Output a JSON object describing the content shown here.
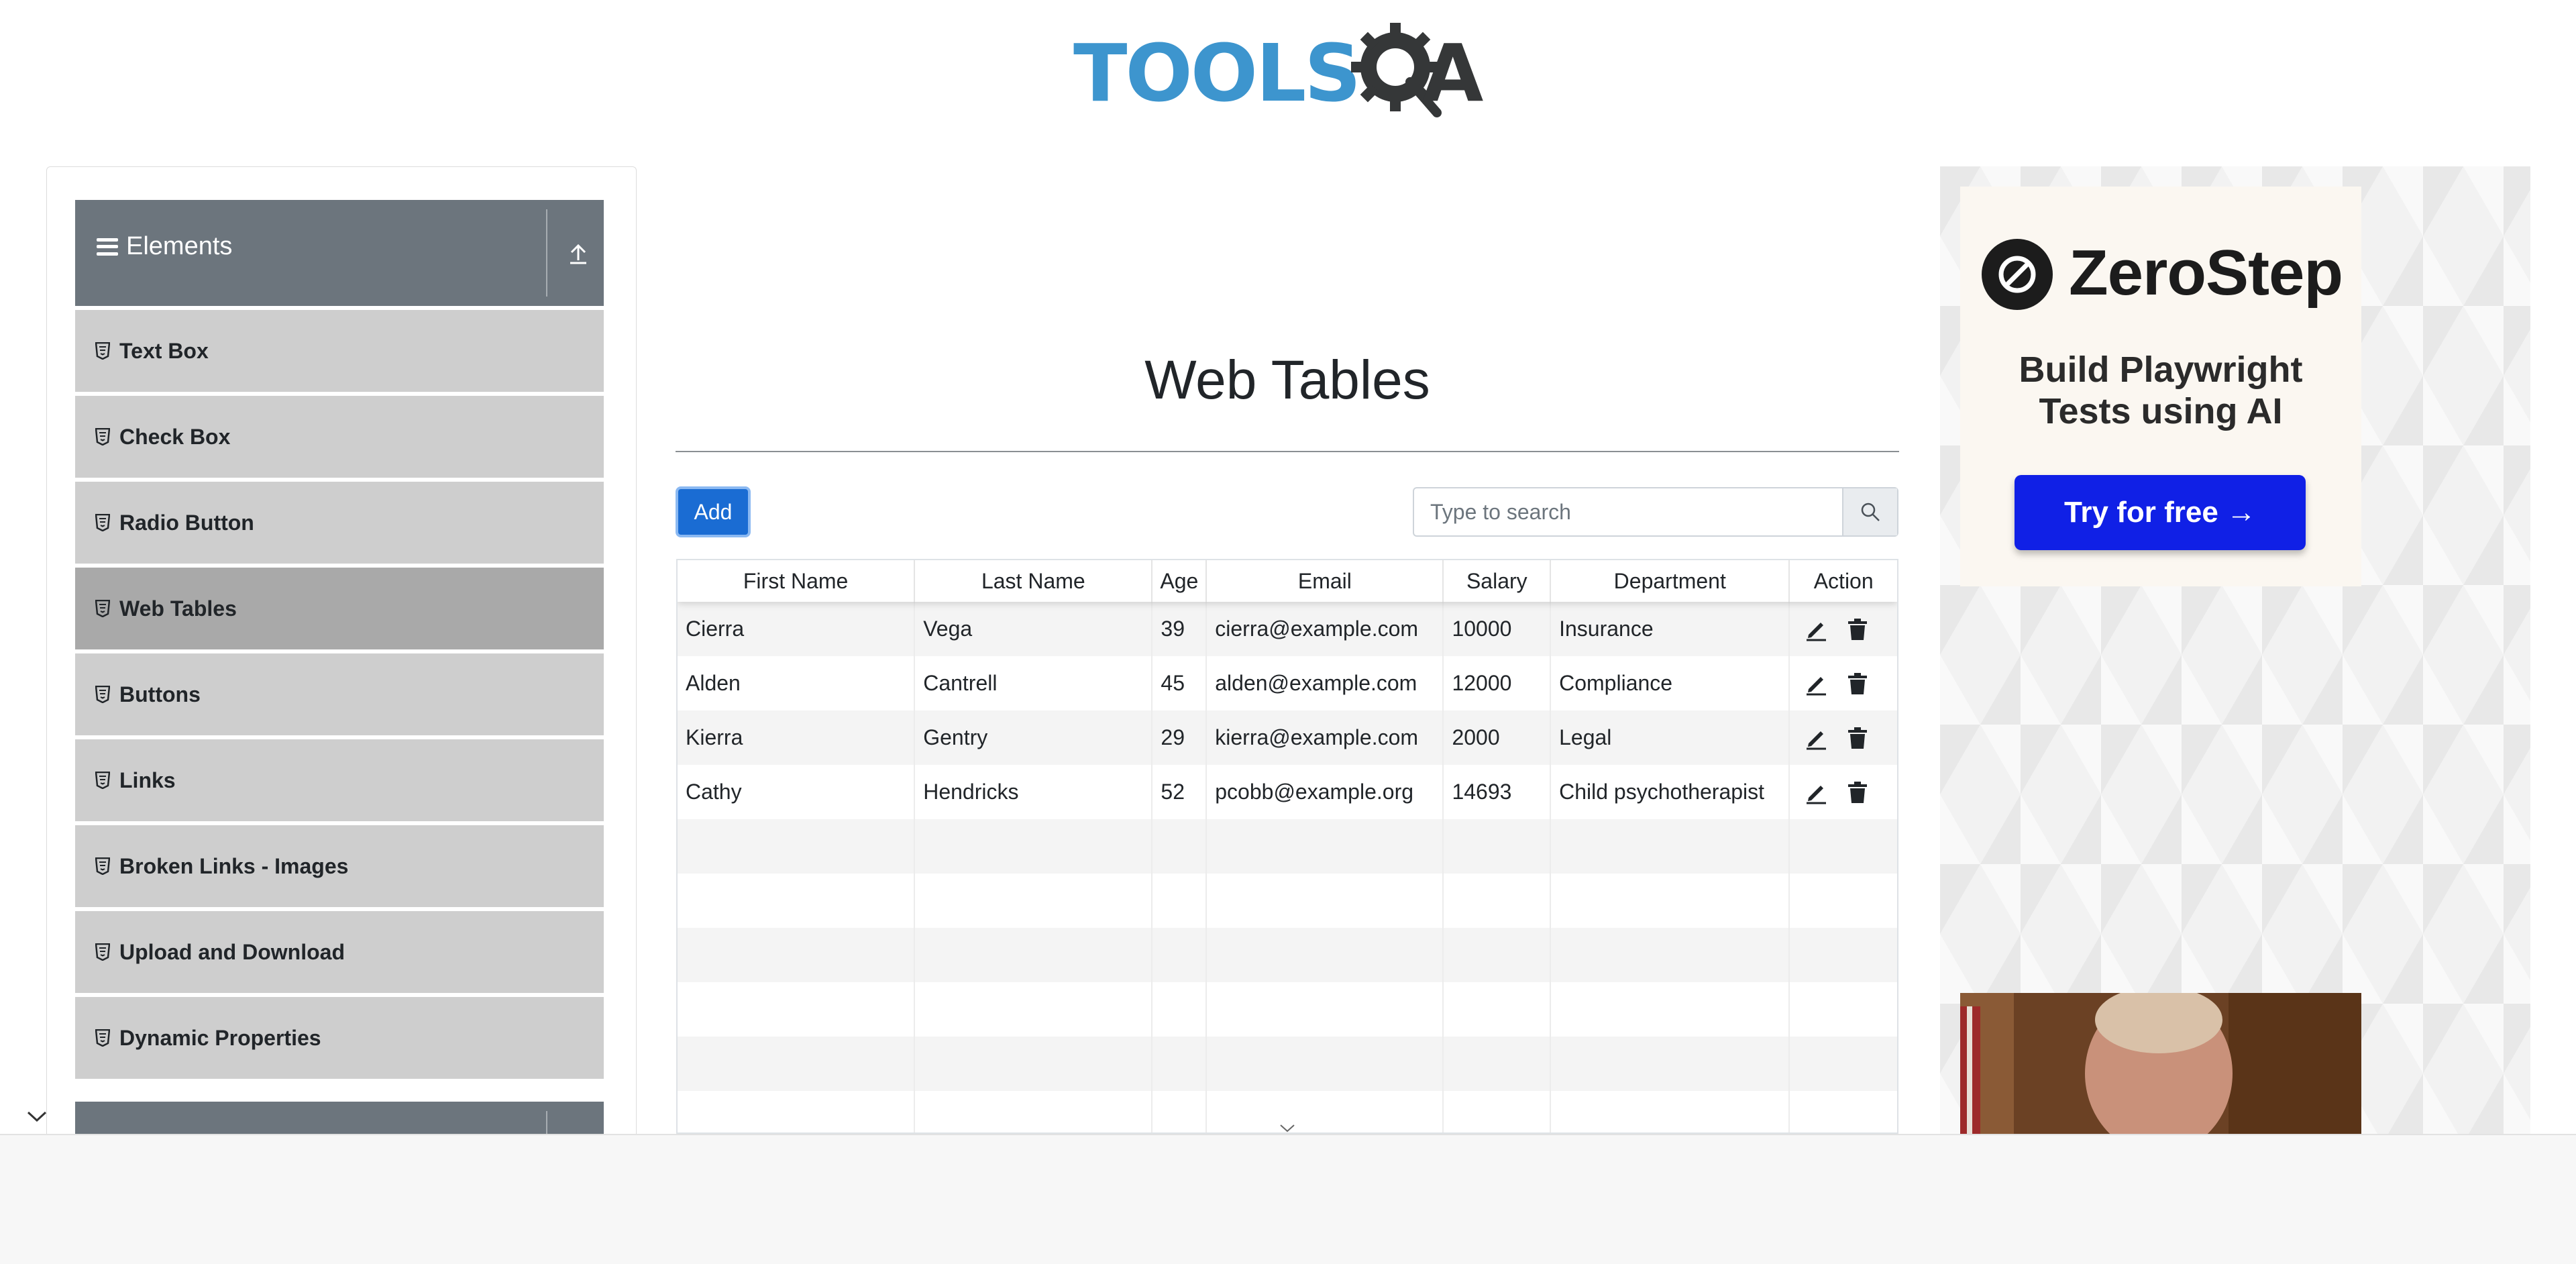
{
  "header": {
    "logo_text_left": "TOOLS",
    "logo_text_right": "A"
  },
  "sidebar": {
    "group_title": "Elements",
    "items": [
      {
        "label": "Text Box",
        "active": false
      },
      {
        "label": "Check Box",
        "active": false
      },
      {
        "label": "Radio Button",
        "active": false
      },
      {
        "label": "Web Tables",
        "active": true
      },
      {
        "label": "Buttons",
        "active": false
      },
      {
        "label": "Links",
        "active": false
      },
      {
        "label": "Broken Links - Images",
        "active": false
      },
      {
        "label": "Upload and Download",
        "active": false
      },
      {
        "label": "Dynamic Properties",
        "active": false
      }
    ]
  },
  "main": {
    "title": "Web Tables",
    "add_label": "Add",
    "search_placeholder": "Type to search",
    "columns": [
      "First Name",
      "Last Name",
      "Age",
      "Email",
      "Salary",
      "Department",
      "Action"
    ],
    "rows": [
      [
        "Cierra",
        "Vega",
        "39",
        "cierra@example.com",
        "10000",
        "Insurance"
      ],
      [
        "Alden",
        "Cantrell",
        "45",
        "alden@example.com",
        "12000",
        "Compliance"
      ],
      [
        "Kierra",
        "Gentry",
        "29",
        "kierra@example.com",
        "2000",
        "Legal"
      ],
      [
        "Cathy",
        "Hendricks",
        "52",
        "pcobb@example.org",
        "14693",
        "Child psychotherapist"
      ],
      [
        "",
        "",
        "",
        "",
        "",
        ""
      ],
      [
        "",
        "",
        "",
        "",
        "",
        ""
      ],
      [
        "",
        "",
        "",
        "",
        "",
        ""
      ],
      [
        "",
        "",
        "",
        "",
        "",
        ""
      ],
      [
        "",
        "",
        "",
        "",
        "",
        ""
      ],
      [
        "",
        "",
        "",
        "",
        "",
        ""
      ]
    ]
  },
  "ad": {
    "brand": "ZeroStep",
    "tagline_line1": "Build Playwright",
    "tagline_line2": "Tests using AI",
    "cta": "Try for free →"
  },
  "colors": {
    "accent": "#1a6cd3",
    "sidebar_header": "#6c757d",
    "menu_item": "#cecece",
    "menu_active": "#a9a9a9",
    "logo_blue": "#3d95ce",
    "ad_button": "#1020e6"
  }
}
